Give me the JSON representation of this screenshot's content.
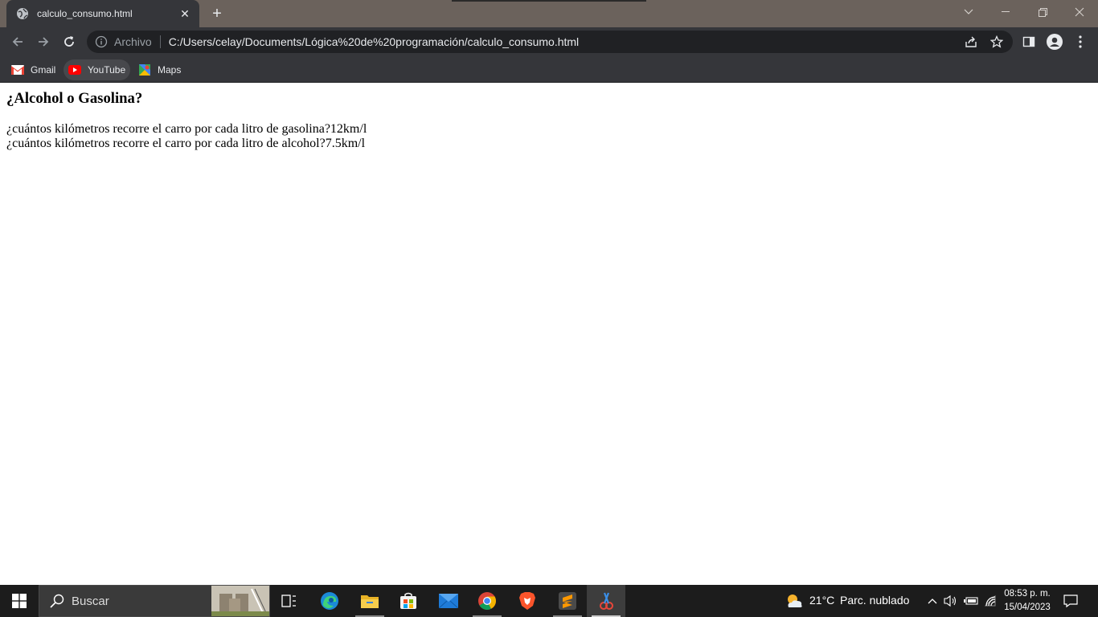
{
  "browser": {
    "tab_title": "calculo_consumo.html",
    "tab_close_icon": "close-icon",
    "new_tab_icon": "plus-icon",
    "omnibox": {
      "scheme_label": "Archivo",
      "url": "C:/Users/celay/Documents/Lógica%20de%20programación/calculo_consumo.html"
    },
    "bookmarks": [
      {
        "label": "Gmail",
        "icon": "gmail-icon"
      },
      {
        "label": "YouTube",
        "icon": "youtube-icon"
      },
      {
        "label": "Maps",
        "icon": "maps-icon"
      }
    ]
  },
  "page": {
    "heading": "¿Alcohol o Gasolina?",
    "lines": [
      "¿cuántos kilómetros recorre el carro por cada litro de gasolina?12km/l",
      "¿cuántos kilómetros recorre el carro por cada litro de alcohol?7.5km/l"
    ]
  },
  "taskbar": {
    "search_placeholder": "Buscar",
    "weather_temp": "21°C",
    "weather_desc": "Parc. nublado",
    "time": "08:53 p. m.",
    "date": "15/04/2023"
  },
  "colors": {
    "titlebar": "#6b625c",
    "toolbar": "#35363a",
    "omnibox": "#202124",
    "taskbar": "#1c1c1c"
  }
}
